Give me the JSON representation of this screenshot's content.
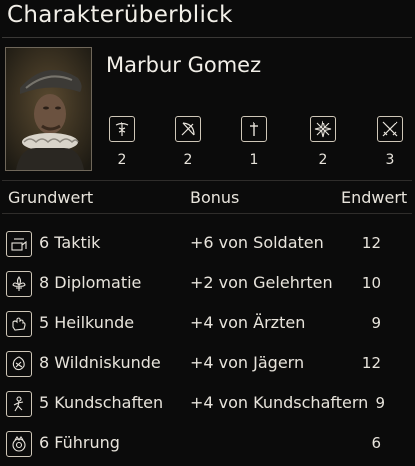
{
  "window": {
    "title": "Charakterüberblick"
  },
  "character": {
    "name": "Marbur Gomez",
    "portrait_alt": "Charakterporträt"
  },
  "skills": [
    {
      "icon": "caduceus-icon",
      "count": "2"
    },
    {
      "icon": "bow-icon",
      "count": "2"
    },
    {
      "icon": "cross-icon",
      "count": "1"
    },
    {
      "icon": "star-compass-icon",
      "count": "2"
    },
    {
      "icon": "crossed-swords-icon",
      "count": "3"
    }
  ],
  "table": {
    "headers": {
      "base": "Grundwert",
      "bonus": "Bonus",
      "final": "Endwert"
    },
    "rows": [
      {
        "icon": "tactics-icon",
        "base": "6 Taktik",
        "bonus": "+6 von Soldaten",
        "final": "12"
      },
      {
        "icon": "fleur-de-lis-icon",
        "base": "8 Diplomatie",
        "bonus": "+2 von Gelehrten",
        "final": "10"
      },
      {
        "icon": "healing-hand-icon",
        "base": "5 Heilkunde",
        "bonus": "+4 von Ärzten",
        "final": "9"
      },
      {
        "icon": "wilderness-icon",
        "base": "8 Wildniskunde",
        "bonus": "+4 von Jägern",
        "final": "12"
      },
      {
        "icon": "scouting-icon",
        "base": "5 Kundschaften",
        "bonus": "+4 von Kundschaftern",
        "final": "9"
      },
      {
        "icon": "leadership-icon",
        "base": "6 Führung",
        "bonus": "",
        "final": "6"
      }
    ]
  },
  "colors": {
    "background": "#0b0b0b",
    "text": "#e8e4dc",
    "frame": "#cfc7b8",
    "portrait_border": "#6f675a"
  }
}
